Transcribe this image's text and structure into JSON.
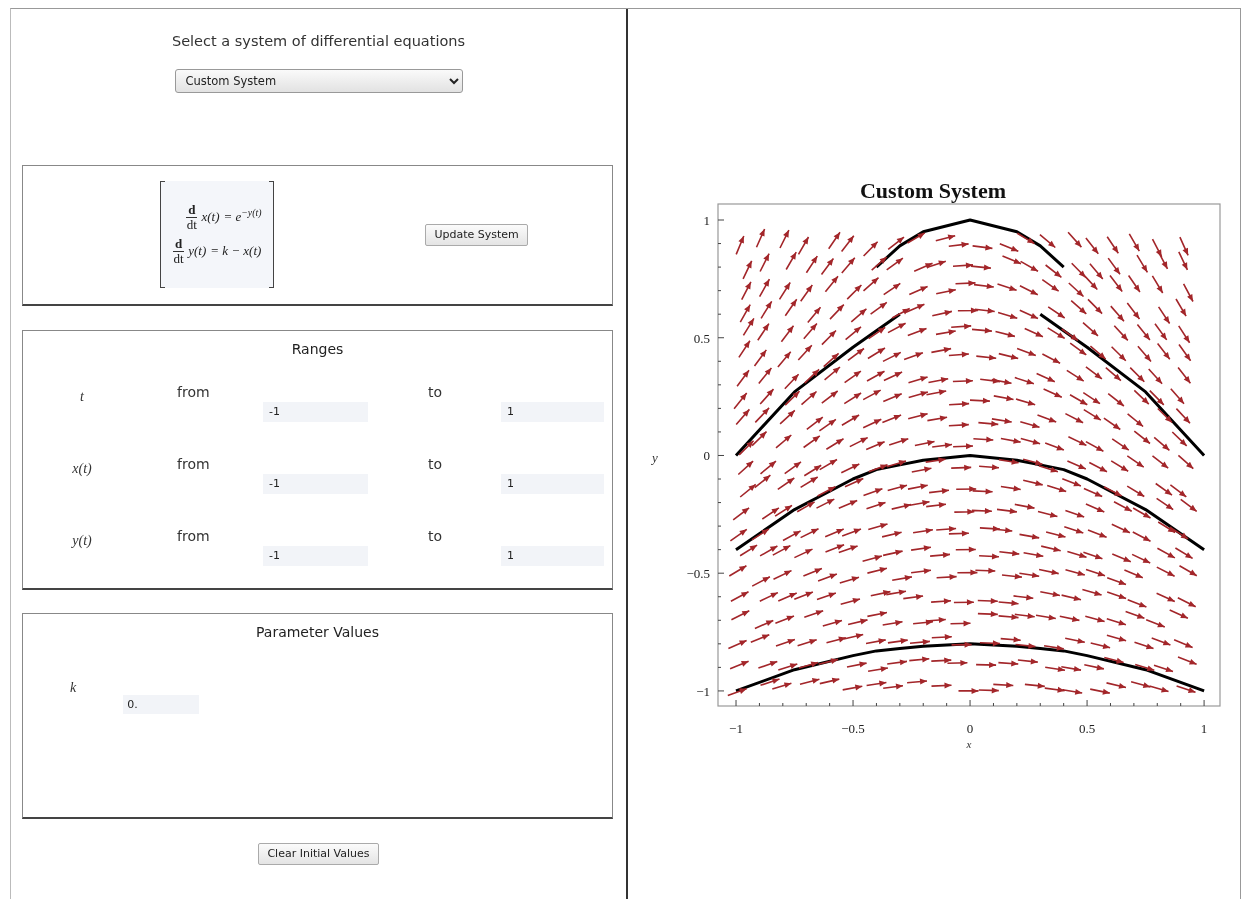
{
  "heading": "Select a system of differential equations",
  "system_select": {
    "value": "Custom System"
  },
  "equations": [
    {
      "numerator": "d",
      "denominator": "dt",
      "function": "x(t)",
      "rhs": "= e$^{−y(t)}$"
    },
    {
      "numerator": "d",
      "denominator": "dt",
      "function": "y(t)",
      "rhs": "= k − x(t)"
    }
  ],
  "update_button": "Update System",
  "ranges": {
    "title": "Ranges",
    "rows": [
      {
        "variable": "t",
        "from_label": "from",
        "from": "-1",
        "to_label": "to",
        "to": "1"
      },
      {
        "variable": "x(t)",
        "from_label": "from",
        "from": "-1",
        "to_label": "to",
        "to": "1"
      },
      {
        "variable": "y(t)",
        "from_label": "from",
        "from": "-1",
        "to_label": "to",
        "to": "1"
      }
    ]
  },
  "parameters": {
    "title": "Parameter Values",
    "items": [
      {
        "name": "k",
        "value": "0."
      }
    ]
  },
  "clear_button": "Clear Initial Values",
  "plot": {
    "chart_data": {
      "type": "line",
      "title": "Custom System",
      "xlabel": "x",
      "ylabel": "y",
      "x": [
        -1,
        -0.75,
        -0.5,
        -0.4,
        -0.3,
        -0.2,
        0,
        0.2,
        0.3,
        0.4,
        0.5,
        0.75,
        1
      ],
      "series": [
        {
          "color": "#000000",
          "values": [
            null,
            null,
            null,
            0.8,
            0.89,
            0.95,
            1,
            0.95,
            0.89,
            0.8,
            null,
            null,
            null
          ]
        },
        {
          "color": "#000000",
          "values": [
            0,
            0.27,
            0.46,
            0.53,
            0.6,
            null,
            null,
            null,
            0.6,
            0.53,
            0.46,
            0.27,
            0
          ]
        },
        {
          "color": "#000000",
          "values": [
            -0.4,
            -0.23,
            -0.1,
            -0.06,
            -0.04,
            -0.02,
            0,
            -0.02,
            -0.04,
            -0.06,
            -0.1,
            -0.23,
            -0.4
          ]
        },
        {
          "color": "#000000",
          "values": [
            -1,
            -0.91,
            -0.85,
            -0.83,
            -0.82,
            -0.81,
            -0.8,
            -0.81,
            -0.82,
            -0.83,
            -0.85,
            -0.91,
            -1
          ]
        }
      ],
      "xlim": [
        -1.077,
        1.068
      ],
      "ylim": [
        -1.064,
        1.068
      ],
      "xticks": [
        -1,
        -0.5,
        0,
        0.5,
        1
      ],
      "yticks": [
        -1,
        -0.5,
        0,
        0.5,
        1
      ]
    }
  }
}
